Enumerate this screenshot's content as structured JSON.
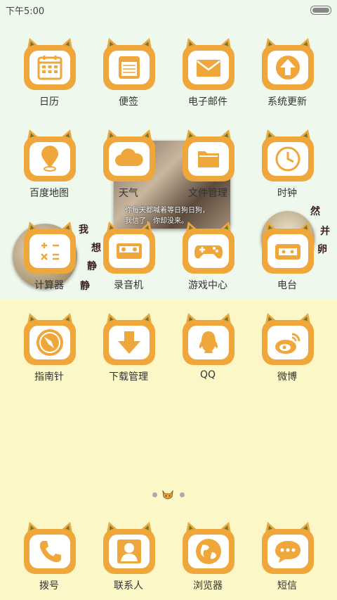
{
  "status_bar": {
    "time": "下午5:00"
  },
  "colors": {
    "accent": "#efa73b",
    "ear_inner": "#6b7a34"
  },
  "page_indicator": {
    "pages": 3,
    "current": 2
  },
  "overlay": {
    "photo_caption_line1": "你每天都喊着等日狗日狗，",
    "photo_caption_line2": "我信了，你却没来。",
    "handwriting_left": [
      "我",
      "想",
      "静",
      "静"
    ],
    "handwriting_right": [
      "然",
      "并",
      "卵"
    ]
  },
  "apps": [
    {
      "label": "日历",
      "icon": "calendar-icon"
    },
    {
      "label": "便签",
      "icon": "notes-icon"
    },
    {
      "label": "电子邮件",
      "icon": "mail-icon"
    },
    {
      "label": "系统更新",
      "icon": "update-icon"
    },
    {
      "label": "百度地图",
      "icon": "map-pin-icon"
    },
    {
      "label": "天气",
      "icon": "cloud-icon"
    },
    {
      "label": "文件管理",
      "icon": "folder-icon"
    },
    {
      "label": "时钟",
      "icon": "clock-icon"
    },
    {
      "label": "计算器",
      "icon": "calculator-icon"
    },
    {
      "label": "录音机",
      "icon": "tape-icon"
    },
    {
      "label": "游戏中心",
      "icon": "gamepad-icon"
    },
    {
      "label": "电台",
      "icon": "radio-icon"
    },
    {
      "label": "指南针",
      "icon": "compass-icon"
    },
    {
      "label": "下载管理",
      "icon": "download-icon"
    },
    {
      "label": "QQ",
      "icon": "qq-penguin-icon"
    },
    {
      "label": "微博",
      "icon": "weibo-icon"
    }
  ],
  "dock": [
    {
      "label": "拨号",
      "icon": "phone-icon"
    },
    {
      "label": "联系人",
      "icon": "contacts-icon"
    },
    {
      "label": "浏览器",
      "icon": "globe-icon"
    },
    {
      "label": "短信",
      "icon": "message-icon"
    }
  ]
}
